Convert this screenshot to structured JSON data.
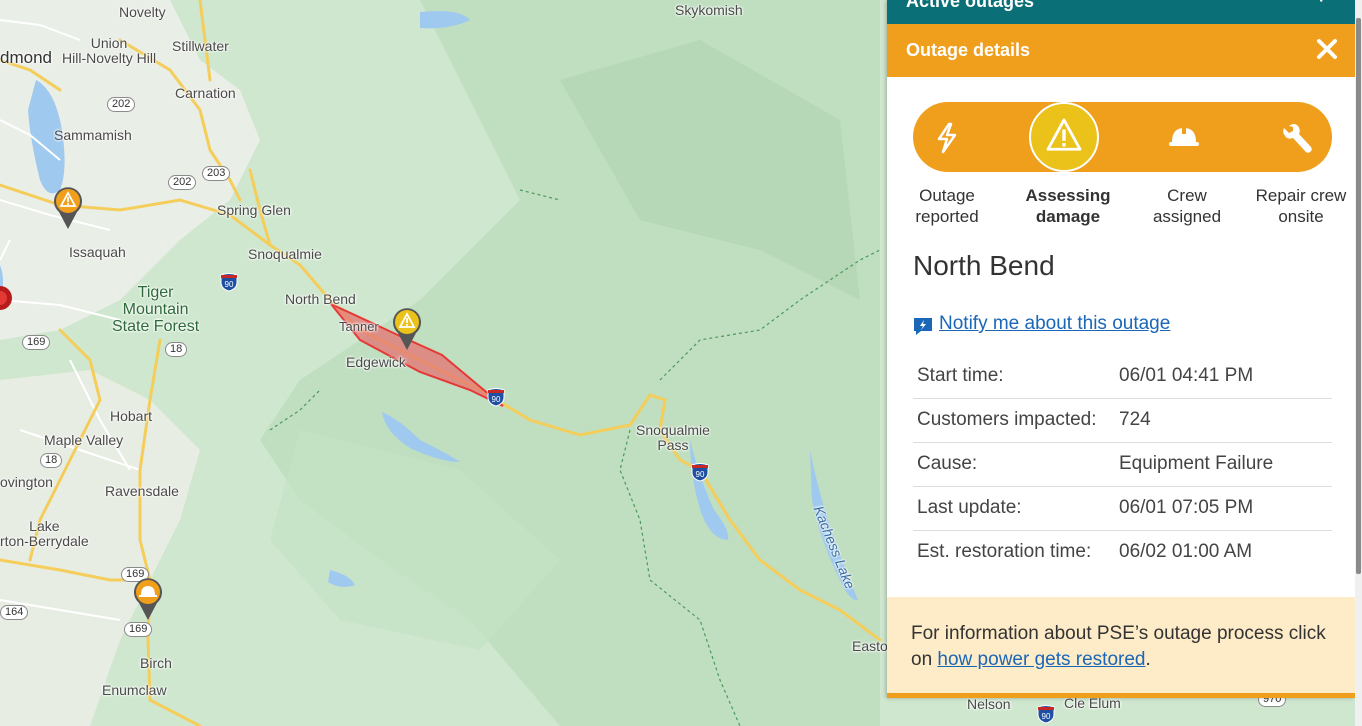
{
  "map": {
    "places": [
      {
        "id": "novelty",
        "text": "Novelty"
      },
      {
        "id": "skykomish",
        "text": "Skykomish"
      },
      {
        "id": "union-hill",
        "text": "Union\nHill-Novelty Hill"
      },
      {
        "id": "stillwater",
        "text": "Stillwater"
      },
      {
        "id": "redmond",
        "text": "dmond"
      },
      {
        "id": "carnation",
        "text": "Carnation"
      },
      {
        "id": "sammamish",
        "text": "Sammamish"
      },
      {
        "id": "spring-glen",
        "text": "Spring Glen"
      },
      {
        "id": "issaquah",
        "text": "Issaquah"
      },
      {
        "id": "snoqualmie",
        "text": "Snoqualmie"
      },
      {
        "id": "tiger-mountain",
        "text": "Tiger\nMountain\nState Forest"
      },
      {
        "id": "north-bend",
        "text": "North Bend"
      },
      {
        "id": "tanner",
        "text": "Tanner"
      },
      {
        "id": "edgewick",
        "text": "Edgewick"
      },
      {
        "id": "hobart",
        "text": "Hobart"
      },
      {
        "id": "maple-valley",
        "text": "Maple Valley"
      },
      {
        "id": "covington",
        "text": "ovington"
      },
      {
        "id": "ravensdale",
        "text": "Ravensdale"
      },
      {
        "id": "lake-morton",
        "text": "Lake\nrton-Berrydale"
      },
      {
        "id": "snoqualmie-pass",
        "text": "Snoqualmie\nPass"
      },
      {
        "id": "kachess-lake",
        "text": "Kachess Lake"
      },
      {
        "id": "birch",
        "text": "Birch"
      },
      {
        "id": "enumclaw",
        "text": "Enumclaw"
      },
      {
        "id": "nelson",
        "text": "Nelson"
      },
      {
        "id": "cle-elum",
        "text": "Cle Elum"
      },
      {
        "id": "easton",
        "text": "Easto"
      }
    ],
    "route_shields": [
      "202",
      "202",
      "203",
      "169",
      "18",
      "18",
      "169",
      "169",
      "164",
      "970"
    ],
    "interstate_label": "90",
    "outage_pins": [
      "assessing-damage",
      "assessing-damage",
      "crew-assigned"
    ]
  },
  "panel": {
    "active_outages_title": "Active outages",
    "details_title": "Outage details",
    "steps": [
      {
        "label": "Outage\nreported",
        "icon": "lightning-icon",
        "active": false
      },
      {
        "label": "Assessing\ndamage",
        "icon": "warning-icon",
        "active": true
      },
      {
        "label": "Crew\nassigned",
        "icon": "hardhat-icon",
        "active": false
      },
      {
        "label": "Repair crew\nonsite",
        "icon": "wrench-icon",
        "active": false
      }
    ],
    "area_name": "North Bend",
    "notify_text": "Notify me about this outage",
    "details": [
      {
        "label": "Start time:",
        "value": "06/01 04:41 PM"
      },
      {
        "label": "Customers impacted:",
        "value": "724"
      },
      {
        "label": "Cause:",
        "value": "Equipment Failure"
      },
      {
        "label": "Last update:",
        "value": "06/01 07:05 PM"
      },
      {
        "label": "Est. restoration time:",
        "value": "06/02 01:00 AM"
      }
    ],
    "footer_text_before": "For information about PSE’s outage process click on ",
    "footer_link": "how power gets restored",
    "footer_text_after": "."
  },
  "colors": {
    "header_teal": "#0a6f77",
    "accent_orange": "#ef9f1c",
    "active_step_yellow": "#ebc21a",
    "outage_polygon": "#e53935",
    "footer_bg": "#feebc8",
    "link_blue": "#1a67b8"
  }
}
